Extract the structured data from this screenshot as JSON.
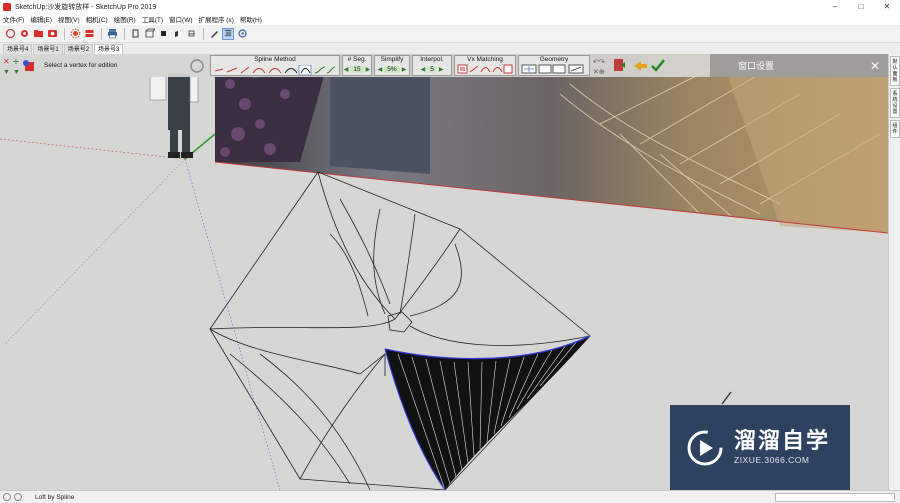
{
  "window": {
    "title": "SketchUp:沙发旋转放样 - SketchUp Pro 2019",
    "minimize": "–",
    "maximize": "□",
    "close": "✕"
  },
  "menu": [
    "文件(F)",
    "编辑(E)",
    "视图(V)",
    "相机(C)",
    "绘图(R)",
    "工具(T)",
    "窗口(W)",
    "扩展程序 (x)",
    "帮助(H)"
  ],
  "scenes": [
    {
      "label": "场景号4",
      "active": false
    },
    {
      "label": "场景号1",
      "active": false
    },
    {
      "label": "场景号2",
      "active": false
    },
    {
      "label": "场景号3",
      "active": true
    }
  ],
  "loft": {
    "status": "Select a vertex for edition",
    "spline_method": "Spline Method",
    "seg_label": "# Seg.",
    "seg_value": "15",
    "simplify_label": "Simplify",
    "simplify_value": "5%",
    "interpol_label": "Interpol.",
    "interpol_value": "5",
    "vx_matching_label": "Vx Matching",
    "geometry_label": "Geometry"
  },
  "window_settings": {
    "label": "窗口设置",
    "close": "✕"
  },
  "right_tabs": [
    "默认面板",
    "系统设置",
    "组件"
  ],
  "watermark": {
    "main": "溜溜自学",
    "sub": "ZIXUE.3066.COM"
  },
  "statusbar": {
    "message": "Loft by Spline"
  },
  "colors": {
    "accent": "#2f3ad8",
    "red_axis": "#c23b3b",
    "green_check": "#1c8a1c"
  }
}
